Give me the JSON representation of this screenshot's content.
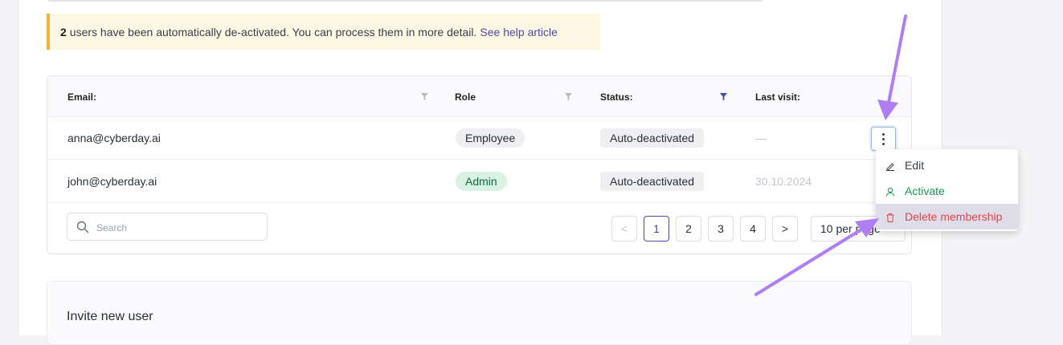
{
  "notice": {
    "count": "2",
    "message": "users have been automatically de-activated. You can process them in more detail.",
    "link": "See help article"
  },
  "table": {
    "columns": [
      {
        "label": "Email:",
        "filter_active": false
      },
      {
        "label": "Role",
        "filter_active": false
      },
      {
        "label": "Status:",
        "filter_active": true
      },
      {
        "label": "Last visit:"
      }
    ],
    "rows": [
      {
        "email": "anna@cyberday.ai",
        "role": "Employee",
        "status": "Auto-deactivated",
        "last_visit": "—"
      },
      {
        "email": "john@cyberday.ai",
        "role": "Admin",
        "status": "Auto-deactivated",
        "last_visit": "30.10.2024"
      }
    ]
  },
  "search": {
    "placeholder": "Search"
  },
  "pagination": {
    "prev": "<",
    "pages": [
      "1",
      "2",
      "3",
      "4"
    ],
    "current": "1",
    "next": ">",
    "per_page": "10 per page"
  },
  "menu": {
    "items": [
      {
        "label": "Edit",
        "icon": "pencil-icon"
      },
      {
        "label": "Activate",
        "icon": "user-icon"
      },
      {
        "label": "Delete membership",
        "icon": "trash-icon"
      }
    ]
  },
  "invite": {
    "title": "Invite new user"
  },
  "colors": {
    "accent": "#4b4aa8",
    "warning": "#f2b33d",
    "success": "#1a9a4f",
    "danger": "#e0454c",
    "annotation": "#b07ef2"
  }
}
